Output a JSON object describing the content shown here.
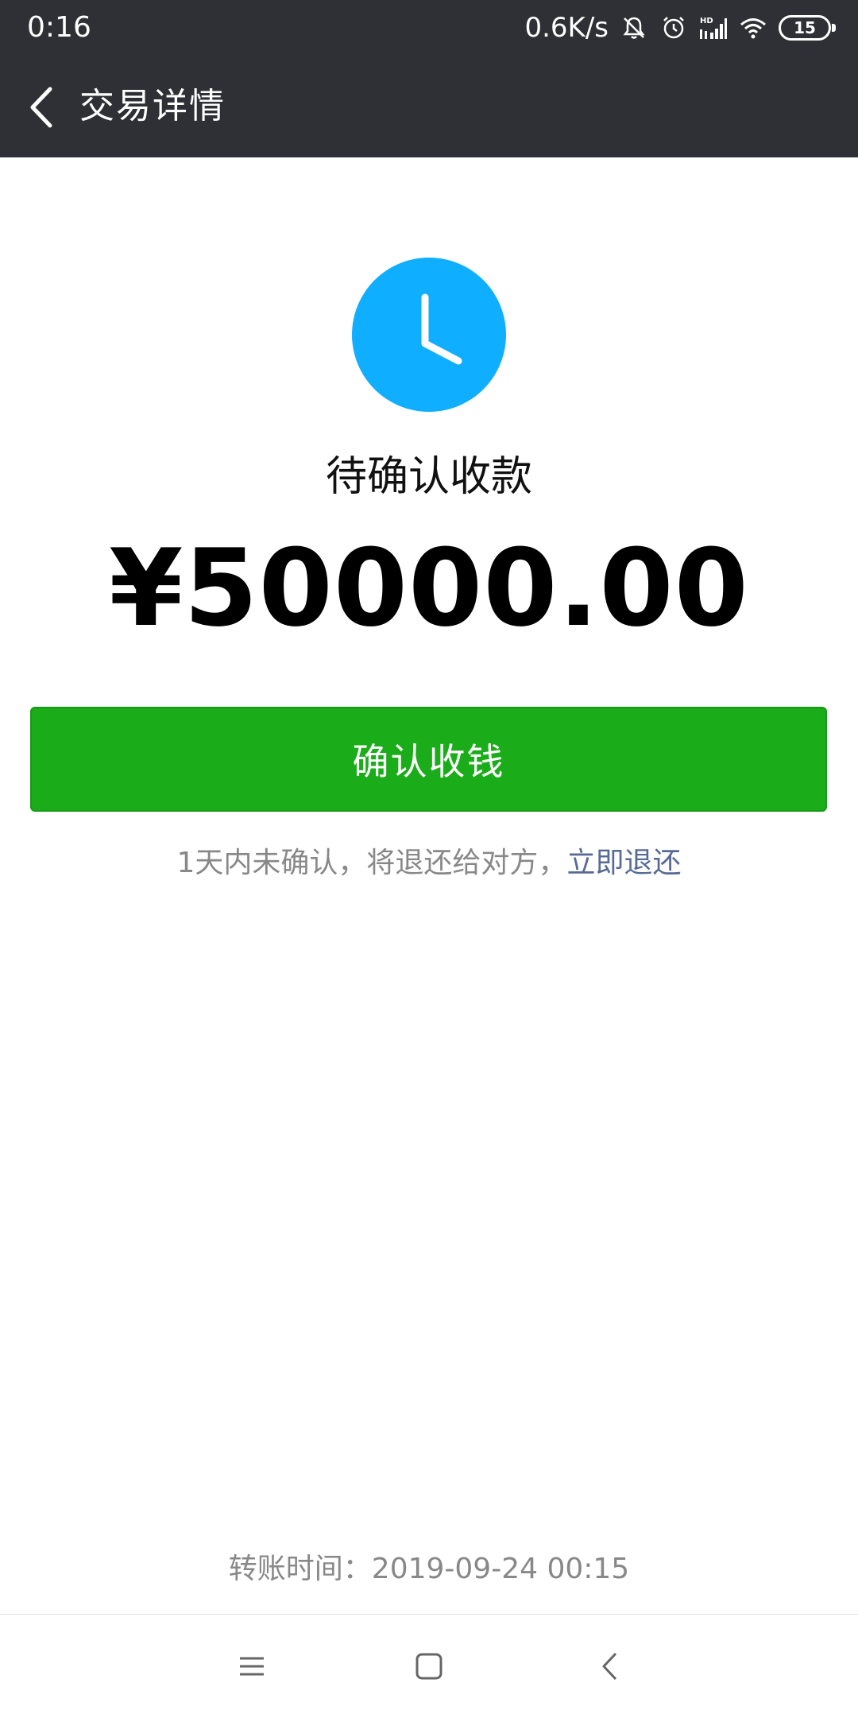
{
  "status_bar": {
    "time": "0:16",
    "network_speed": "0.6K/s",
    "battery_level": "15",
    "icons": [
      "bell-muted-icon",
      "alarm-icon",
      "hd-signal-icon",
      "wifi-icon",
      "battery-icon"
    ]
  },
  "nav": {
    "title": "交易详情",
    "back_icon": "chevron-left-icon"
  },
  "transaction": {
    "status_icon": "clock-icon",
    "status_color": "#10aeff",
    "status": "待确认收款",
    "amount": "¥50000.00",
    "confirm_label": "确认收钱",
    "confirm_color": "#1aad19",
    "notice": "1天内未确认，将退还给对方，",
    "refund_link": "立即退还",
    "link_color": "#576b95",
    "transfer_time": "转账时间：2019-09-24 00:15"
  },
  "system_nav": {
    "icons": [
      "menu-icon",
      "home-icon",
      "back-icon"
    ]
  }
}
